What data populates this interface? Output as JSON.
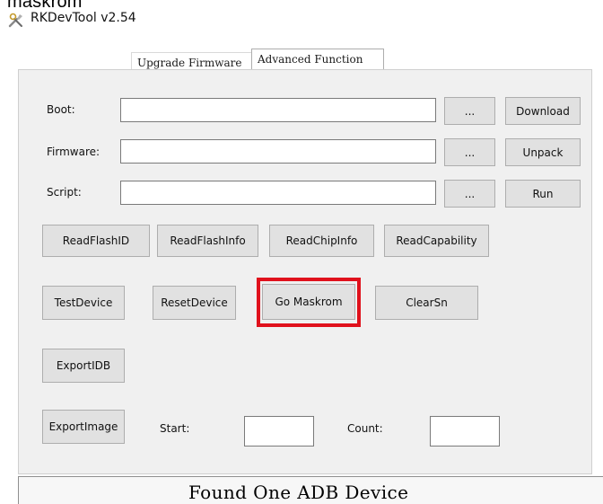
{
  "window": {
    "cut_off_heading": "maskrom",
    "title": "RKDevTool v2.54"
  },
  "tabs": [
    {
      "label": "Upgrade Firmware",
      "active": false
    },
    {
      "label": "Advanced Function",
      "active": true
    }
  ],
  "form": {
    "boot_label": "Boot:",
    "boot_value": "",
    "boot_browse": "...",
    "boot_action": "Download",
    "firmware_label": "Firmware:",
    "firmware_value": "",
    "firmware_browse": "...",
    "firmware_action": "Unpack",
    "script_label": "Script:",
    "script_value": "",
    "script_browse": "...",
    "script_action": "Run"
  },
  "buttons": {
    "read_flash_id": "ReadFlashID",
    "read_flash_info": "ReadFlashInfo",
    "read_chip_info": "ReadChipInfo",
    "read_capability": "ReadCapability",
    "test_device": "TestDevice",
    "reset_device": "ResetDevice",
    "go_maskrom": "Go Maskrom",
    "clear_sn": "ClearSn",
    "export_idb": "ExportIDB",
    "export_image": "ExportImage"
  },
  "export": {
    "start_label": "Start:",
    "start_value": "",
    "count_label": "Count:",
    "count_value": ""
  },
  "status": {
    "message": "Found One ADB Device"
  },
  "colors": {
    "highlight": "#e0111c",
    "panel": "#f0f0f0",
    "button": "#e1e1e1"
  },
  "icons": {
    "app_icon": "tools-icon"
  }
}
